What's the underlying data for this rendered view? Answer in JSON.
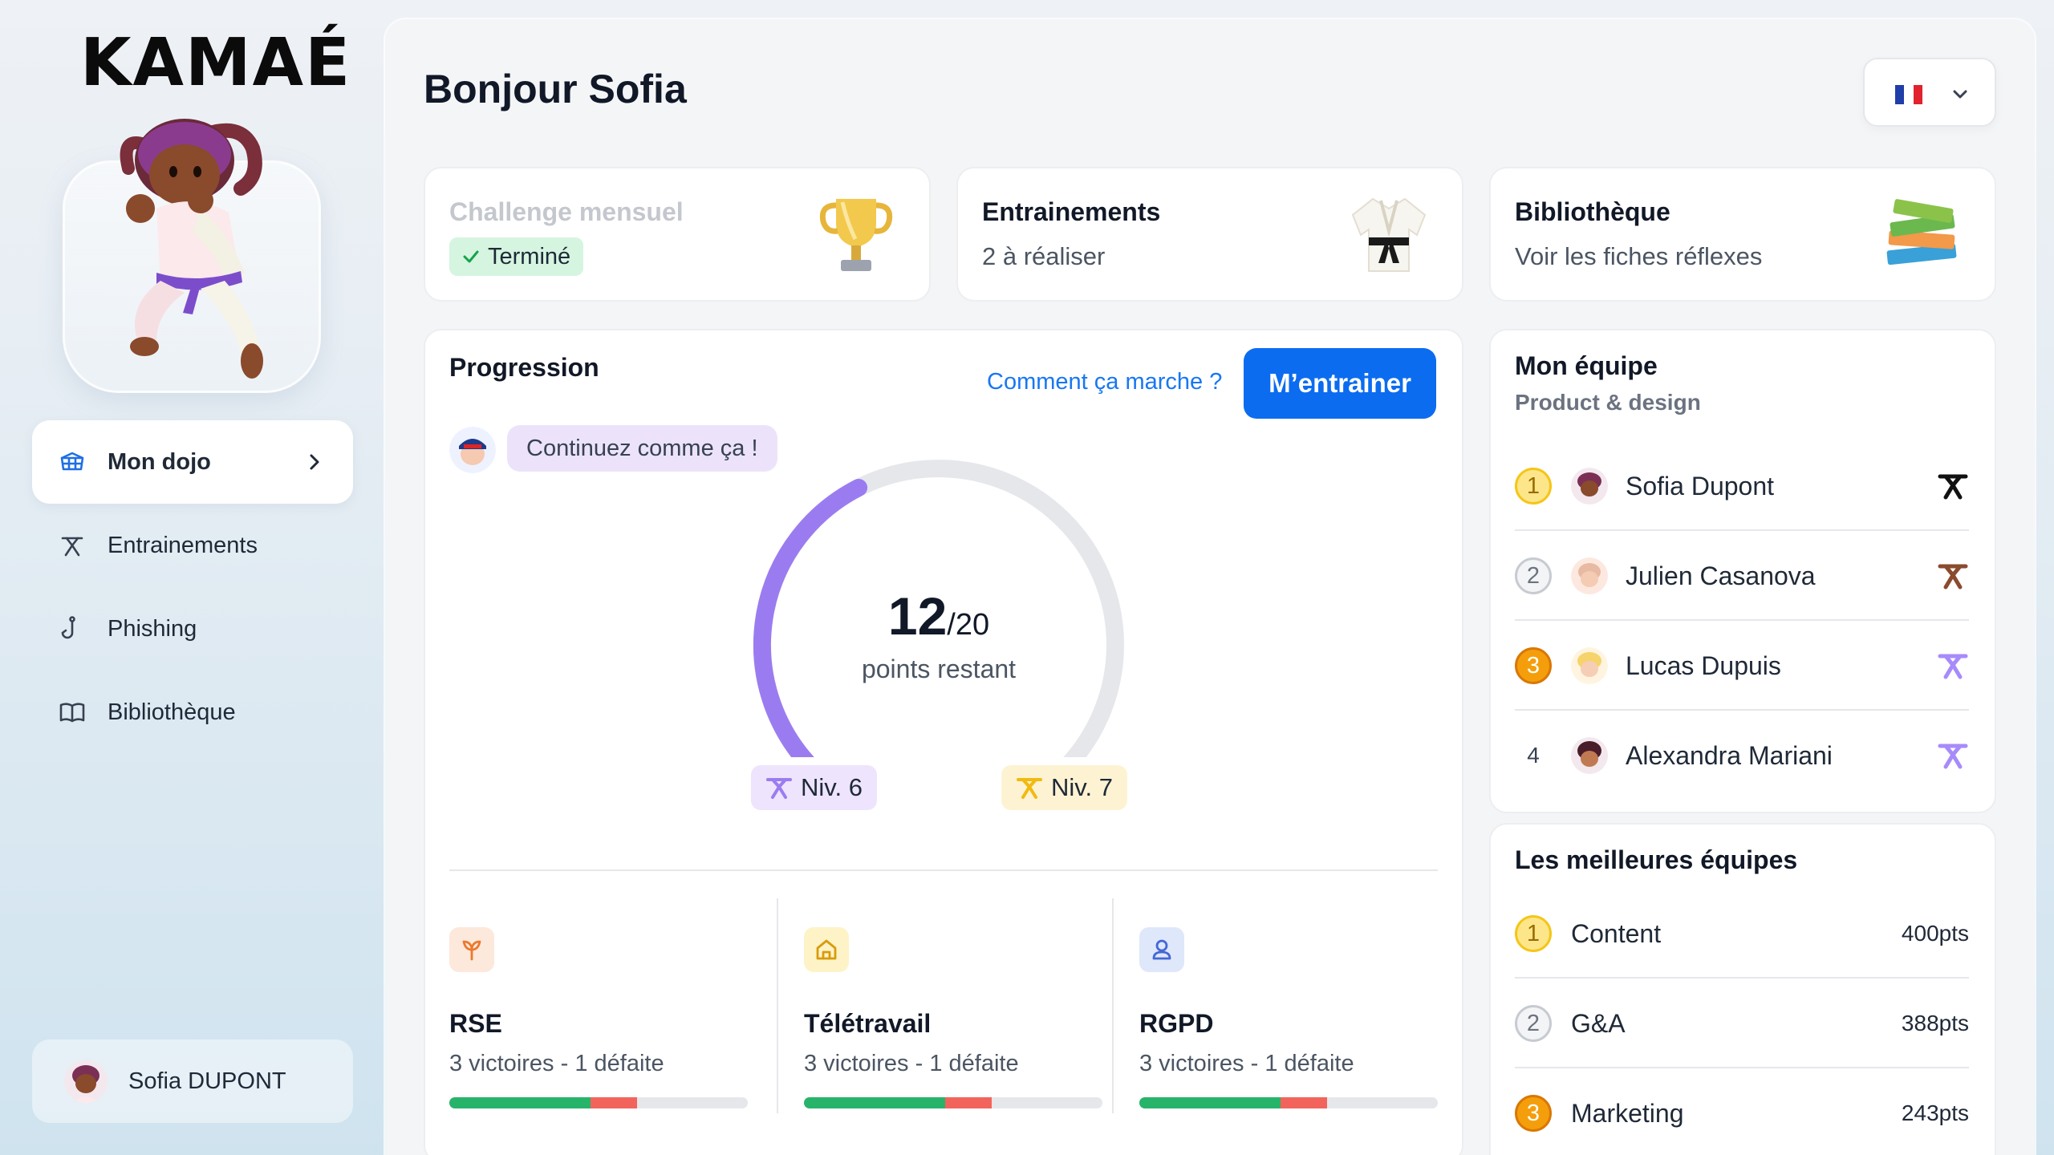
{
  "brand": {
    "logo": "KAMAÉ"
  },
  "sidebar": {
    "items": [
      {
        "label": "Mon dojo",
        "icon": "dojo-icon",
        "active": true
      },
      {
        "label": "Entrainements",
        "icon": "belt-icon",
        "active": false
      },
      {
        "label": "Phishing",
        "icon": "hook-icon",
        "active": false
      },
      {
        "label": "Bibliothèque",
        "icon": "book-icon",
        "active": false
      }
    ],
    "user": {
      "name": "Sofia DUPONT"
    }
  },
  "header": {
    "greeting": "Bonjour Sofia",
    "language": {
      "icon": "flag-fr-icon",
      "colors": [
        "#1f3ea8",
        "#ffffff",
        "#e0232e"
      ]
    }
  },
  "cards": {
    "challenge": {
      "title": "Challenge mensuel",
      "status": "Terminé",
      "icon": "trophy-icon"
    },
    "trainings": {
      "title": "Entrainements",
      "subtitle": "2 à réaliser",
      "icon": "kimono-icon"
    },
    "library": {
      "title": "Bibliothèque",
      "subtitle": "Voir les fiches réflexes",
      "icon": "books-icon"
    }
  },
  "progression": {
    "title": "Progression",
    "help_link": "Comment ça marche ?",
    "cta": "M’entrainer",
    "message": "Continuez comme ça !",
    "points": "12",
    "points_total": "/20",
    "points_label": "points restant",
    "progress_fraction": 0.4,
    "level_current": "Niv. 6",
    "level_next": "Niv. 7",
    "colors": {
      "arc": "#9b7cf0",
      "track": "#e5e7eb",
      "level6": "#9b7cf0",
      "level7": "#f2b90f"
    },
    "topics": [
      {
        "name": "RSE",
        "stats": "3 victoires - 1 défaite",
        "icon": "sprout-icon",
        "wins": 3,
        "losses": 1
      },
      {
        "name": "Télétravail",
        "stats": "3 victoires - 1 défaite",
        "icon": "home-icon",
        "wins": 3,
        "losses": 1
      },
      {
        "name": "RGPD",
        "stats": "3 victoires - 1 défaite",
        "icon": "user-icon",
        "wins": 3,
        "losses": 1
      }
    ]
  },
  "team": {
    "title": "Mon équipe",
    "subtitle": "Product & design",
    "members": [
      {
        "rank": "1",
        "name": "Sofia Dupont",
        "belt_color": "#111111"
      },
      {
        "rank": "2",
        "name": "Julien Casanova",
        "belt_color": "#8a4b2e"
      },
      {
        "rank": "3",
        "name": "Lucas Dupuis",
        "belt_color": "#a78bfa"
      },
      {
        "rank": "4",
        "name": "Alexandra Mariani",
        "belt_color": "#a78bfa"
      }
    ]
  },
  "best_teams": {
    "title": "Les meilleures équipes",
    "teams": [
      {
        "rank": "1",
        "name": "Content",
        "points": "400pts"
      },
      {
        "rank": "2",
        "name": "G&A",
        "points": "388pts"
      },
      {
        "rank": "3",
        "name": "Marketing",
        "points": "243pts"
      }
    ]
  }
}
